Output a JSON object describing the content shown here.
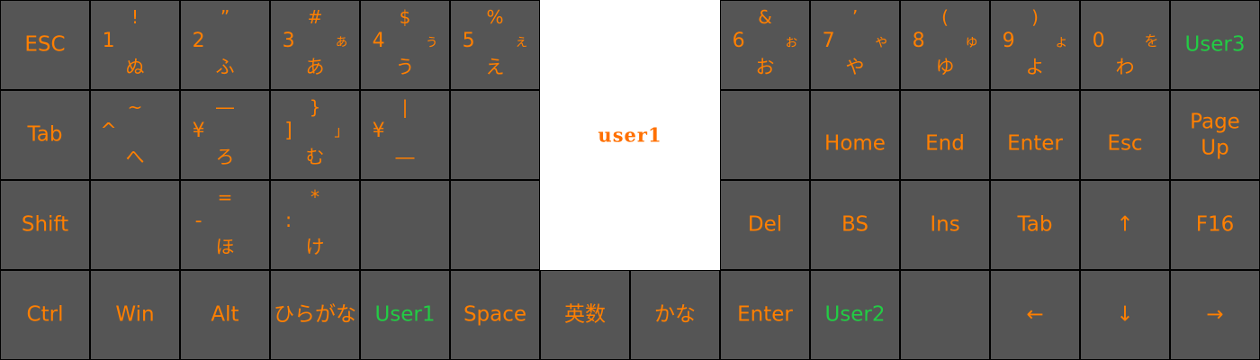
{
  "colors": {
    "key_bg": "#555555",
    "label": "#ff7f00",
    "user_label": "#22cc44",
    "logo": "#ff7000"
  },
  "logo": "user1",
  "rows": [
    [
      {
        "center": "ESC"
      },
      {
        "top": "!",
        "left": "1",
        "bottom": "ぬ"
      },
      {
        "top": "”",
        "left": "2",
        "bottom": "ふ"
      },
      {
        "top": "#",
        "left": "3",
        "right": "ぁ",
        "bottom": "あ"
      },
      {
        "top": "$",
        "left": "4",
        "right": "ぅ",
        "bottom": "う"
      },
      {
        "top": "%",
        "left": "5",
        "right": "ぇ",
        "bottom": "え"
      },
      null,
      null,
      {
        "top": "&",
        "left": "6",
        "right": "ぉ",
        "bottom": "お"
      },
      {
        "top": "’",
        "left": "7",
        "right": "ゃ",
        "bottom": "や"
      },
      {
        "top": "(",
        "left": "8",
        "right": "ゅ",
        "bottom": "ゆ"
      },
      {
        "top": ")",
        "left": "9",
        "right": "ょ",
        "bottom": "よ"
      },
      {
        "left": "0",
        "right": "を",
        "bottom": "わ"
      },
      {
        "center": "User3",
        "green": true
      }
    ],
    [
      {
        "center": "Tab"
      },
      {
        "top": "~",
        "left": "^",
        "bottom": "へ"
      },
      {
        "top": "―",
        "left": "¥",
        "bottom": "ろ"
      },
      {
        "top": "}",
        "left": "]",
        "right": "」",
        "bottom": "む"
      },
      {
        "top": "|",
        "left": "¥",
        "bottom": "―"
      },
      {},
      null,
      null,
      {},
      {
        "center": "Home",
        "low": true
      },
      {
        "center": "End",
        "low": true
      },
      {
        "center": "Enter",
        "low": true
      },
      {
        "center": "Esc",
        "low": true
      },
      {
        "center": "Page\nUp"
      }
    ],
    [
      {
        "center": "Shift"
      },
      {},
      {
        "top": "=",
        "left": "-",
        "bottom": "ほ"
      },
      {
        "top": "*",
        "left": ":",
        "bottom": "け"
      },
      {},
      {},
      null,
      null,
      {
        "center": "Del"
      },
      {
        "center": "BS"
      },
      {
        "center": "Ins"
      },
      {
        "center": "Tab"
      },
      {
        "center": "↑"
      },
      {
        "center": "F16"
      }
    ],
    [
      {
        "center": "Ctrl"
      },
      {
        "center": "Win"
      },
      {
        "center": "Alt"
      },
      {
        "center": "ひらがな"
      },
      {
        "center": "User1",
        "green": true
      },
      {
        "center": "Space"
      },
      {
        "center": "英数"
      },
      {
        "center": "かな"
      },
      {
        "center": "Enter"
      },
      {
        "center": "User2",
        "green": true
      },
      {},
      {
        "center": "←"
      },
      {
        "center": "↓"
      },
      {
        "center": "→"
      }
    ]
  ]
}
